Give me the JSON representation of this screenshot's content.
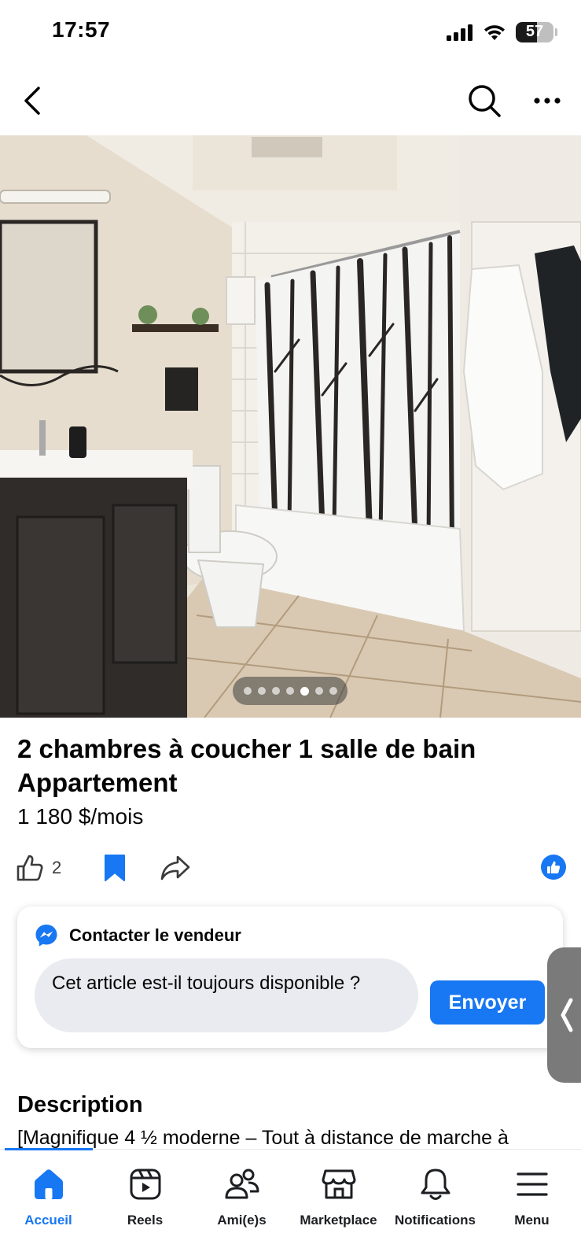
{
  "status_bar": {
    "time": "17:57",
    "battery_level": "57",
    "icons": [
      "signal-icon",
      "wifi-icon",
      "battery-icon"
    ]
  },
  "top_nav": {
    "icons": [
      "back-arrow-icon",
      "search-icon",
      "more-icon"
    ]
  },
  "photo": {
    "pager_count": 7,
    "active_index": 4
  },
  "listing": {
    "title": "2 chambres à coucher 1 salle de bain Appartement",
    "price": "1 180 $/mois"
  },
  "actions": {
    "like_count": "2",
    "saved": true,
    "icons": [
      "thumbs-up-icon",
      "bookmark-icon",
      "share-icon",
      "like-badge-icon"
    ]
  },
  "contact": {
    "title": "Contacter le vendeur",
    "message": "Cet article est-il toujours disponible ?",
    "send_label": "Envoyer"
  },
  "description": {
    "heading": "Description",
    "text": "[Magnifique 4 ½ moderne – Tout à distance de marche à"
  },
  "tab_bar": {
    "active": "Accueil",
    "tabs": [
      {
        "label": "Accueil",
        "icon": "home-icon"
      },
      {
        "label": "Reels",
        "icon": "reels-icon"
      },
      {
        "label": "Ami(e)s",
        "icon": "friends-icon"
      },
      {
        "label": "Marketplace",
        "icon": "marketplace-icon"
      },
      {
        "label": "Notifications",
        "icon": "bell-icon"
      },
      {
        "label": "Menu",
        "icon": "menu-icon"
      }
    ]
  },
  "colors": {
    "accent": "#1877f2",
    "text": "#050505",
    "input_bg": "#e9ebf0"
  }
}
